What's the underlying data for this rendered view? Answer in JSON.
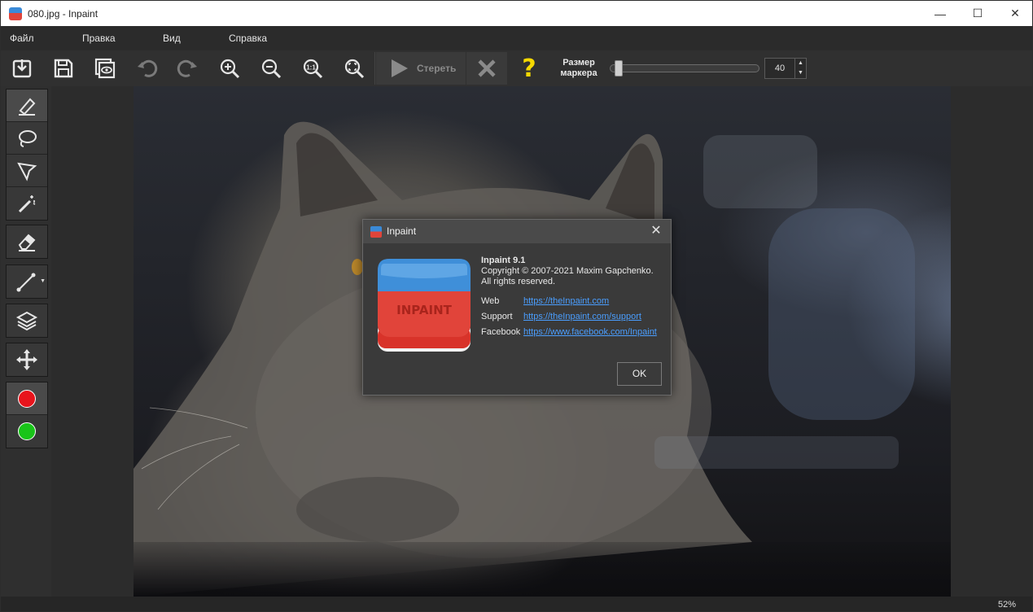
{
  "window": {
    "title": "080.jpg - Inpaint",
    "controls": {
      "minimize": "—",
      "maximize": "☐",
      "close": "✕"
    }
  },
  "menu": {
    "items": [
      "Файл",
      "Правка",
      "Вид",
      "Справка"
    ]
  },
  "toolbar": {
    "icons": [
      "open-icon",
      "save-icon",
      "preview-icon",
      "undo-icon",
      "redo-icon",
      "zoom-in-icon",
      "zoom-out-icon",
      "zoom-actual-icon",
      "zoom-fit-icon"
    ],
    "erase_label": "Стереть",
    "help_glyph": "?",
    "marker_size_label_1": "Размер",
    "marker_size_label_2": "маркера",
    "marker_size_value": "40",
    "marker_size_slider_fraction": 0.05
  },
  "left_tools": {
    "icons": [
      "marker-icon",
      "lasso-icon",
      "polygon-lasso-icon",
      "magic-wand-icon",
      "eraser-icon",
      "line-icon",
      "layers-icon",
      "move-icon"
    ],
    "colors": {
      "red": "#e8141c",
      "green": "#19c419"
    }
  },
  "status": {
    "zoom": "52%"
  },
  "about_dialog": {
    "title": "Inpaint",
    "logo_text": "INPAINT",
    "product": "Inpaint 9.1",
    "copyright": "Copyright © 2007-2021 Maxim Gapchenko.",
    "rights": "All rights reserved.",
    "web_label": "Web",
    "web_link": "https://theInpaint.com",
    "support_label": "Support",
    "support_link": "https://theInpaint.com/support",
    "facebook_label": "Facebook",
    "facebook_link": "https://www.facebook.com/Inpaint",
    "ok_label": "OK"
  },
  "colors": {
    "accent_link": "#4a9eff",
    "help_yellow": "#f5d800"
  }
}
